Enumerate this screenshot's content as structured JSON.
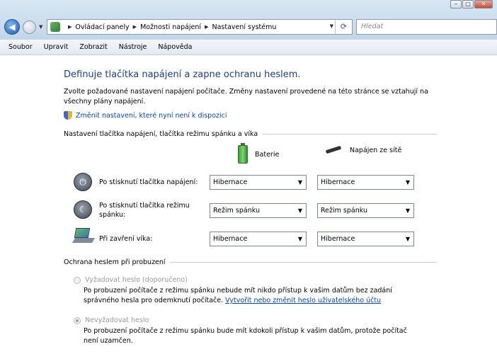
{
  "window": {
    "controls": [
      "minimize-icon",
      "maximize-icon",
      "close-icon"
    ]
  },
  "address_bar": {
    "crumbs": [
      "Ovládací panely",
      "Možnosti napájení",
      "Nastavení systému"
    ]
  },
  "search": {
    "placeholder": "Hledat"
  },
  "menu": [
    "Soubor",
    "Upravit",
    "Zobrazit",
    "Nástroje",
    "Nápověda"
  ],
  "page": {
    "title": "Definuje tlačítka napájení a zapne ochranu heslem.",
    "description": "Zvolte požadované nastavení napájení počítače. Změny nastavení provedené na této stránce se vztahují na všechny plány napájení.",
    "change_link": "Změnit nastavení, které nyní není k dispozici"
  },
  "buttons_section": {
    "heading": "Nastavení tlačítka napájení, tlačítka režimu spánku a víka",
    "col_battery": "Baterie",
    "col_plugged": "Napájen ze sítě",
    "rows": [
      {
        "label": "Po stisknutí tlačítka napájení:",
        "battery": "Hibernace",
        "plugged": "Hibernace"
      },
      {
        "label": "Po stisknutí tlačítka režimu spánku:",
        "battery": "Režim spánku",
        "plugged": "Režim spánku"
      },
      {
        "label": "Při zavření víka:",
        "battery": "Hibernace",
        "plugged": "Hibernace"
      }
    ]
  },
  "password_section": {
    "heading": "Ochrana heslem při probuzení",
    "option1_label": "Vyžadovat heslo (doporučeno)",
    "option1_desc": "Po probuzení počítače z režimu spánku nebude mít nikdo přístup k vašim datům bez zadání správného hesla pro odemknutí počítače.",
    "option1_link": "Vytvořit nebo změnit heslo uživatelského účtu",
    "option2_label": "Nevyžadovat heslo",
    "option2_desc": "Po probuzení počítače z režimu spánku bude mít kdokoli přístup k vašim datům, protože počítač není uzamčen.",
    "selected_option": 2
  }
}
